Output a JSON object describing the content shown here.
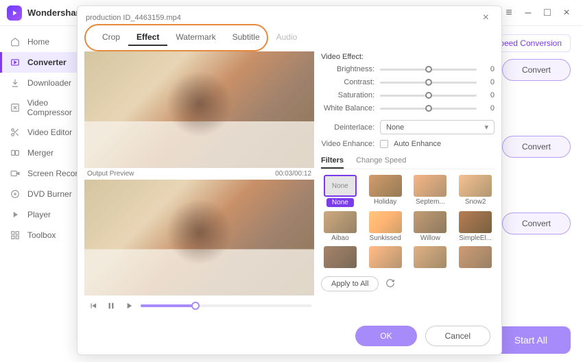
{
  "app": {
    "brand": "Wondershare"
  },
  "window_controls": {
    "menu": "≡",
    "minimize": "–",
    "maximize": "□",
    "close": "×"
  },
  "sidebar": {
    "items": [
      {
        "label": "Home",
        "icon": "home"
      },
      {
        "label": "Converter",
        "icon": "convert"
      },
      {
        "label": "Downloader",
        "icon": "download"
      },
      {
        "label": "Video Compressor",
        "icon": "compress"
      },
      {
        "label": "Video Editor",
        "icon": "scissors"
      },
      {
        "label": "Merger",
        "icon": "merge"
      },
      {
        "label": "Screen Recorder",
        "icon": "record"
      },
      {
        "label": "DVD Burner",
        "icon": "disc"
      },
      {
        "label": "Player",
        "icon": "play"
      },
      {
        "label": "Toolbox",
        "icon": "grid"
      }
    ]
  },
  "main": {
    "chip": "Speed Conversion",
    "convert": "Convert",
    "start_all": "Start All"
  },
  "modal": {
    "filename": "production ID_4463159.mp4",
    "tabs": [
      "Crop",
      "Effect",
      "Watermark",
      "Subtitle",
      "Audio"
    ],
    "active_tab": "Effect",
    "output_label": "Output Preview",
    "time": "00:03/00:12",
    "effect": {
      "title": "Video Effect:",
      "sliders": [
        {
          "label": "Brightness:",
          "value": 0,
          "pos": 50
        },
        {
          "label": "Contrast:",
          "value": 0,
          "pos": 50
        },
        {
          "label": "Saturation:",
          "value": 0,
          "pos": 50
        },
        {
          "label": "White Balance:",
          "value": 0,
          "pos": 50
        }
      ],
      "deinterlace_label": "Deinterlace:",
      "deinterlace_value": "None",
      "enhance_label": "Video Enhance:",
      "auto_enhance": "Auto Enhance"
    },
    "subtabs": [
      "Filters",
      "Change Speed"
    ],
    "active_subtab": "Filters",
    "filters": [
      {
        "name": "None",
        "cls": "none",
        "selected": true
      },
      {
        "name": "Holiday",
        "cls": "f1"
      },
      {
        "name": "Septem...",
        "cls": "f2"
      },
      {
        "name": "Snow2",
        "cls": "f3"
      },
      {
        "name": "Aibao",
        "cls": "f4"
      },
      {
        "name": "Sunkissed",
        "cls": "f5"
      },
      {
        "name": "Willow",
        "cls": "f6"
      },
      {
        "name": "SimpleEl...",
        "cls": "f7"
      },
      {
        "name": "",
        "cls": "f8"
      },
      {
        "name": "",
        "cls": "f9"
      },
      {
        "name": "",
        "cls": "f10"
      },
      {
        "name": "",
        "cls": "f11"
      }
    ],
    "apply_all": "Apply to All",
    "ok": "OK",
    "cancel": "Cancel"
  }
}
